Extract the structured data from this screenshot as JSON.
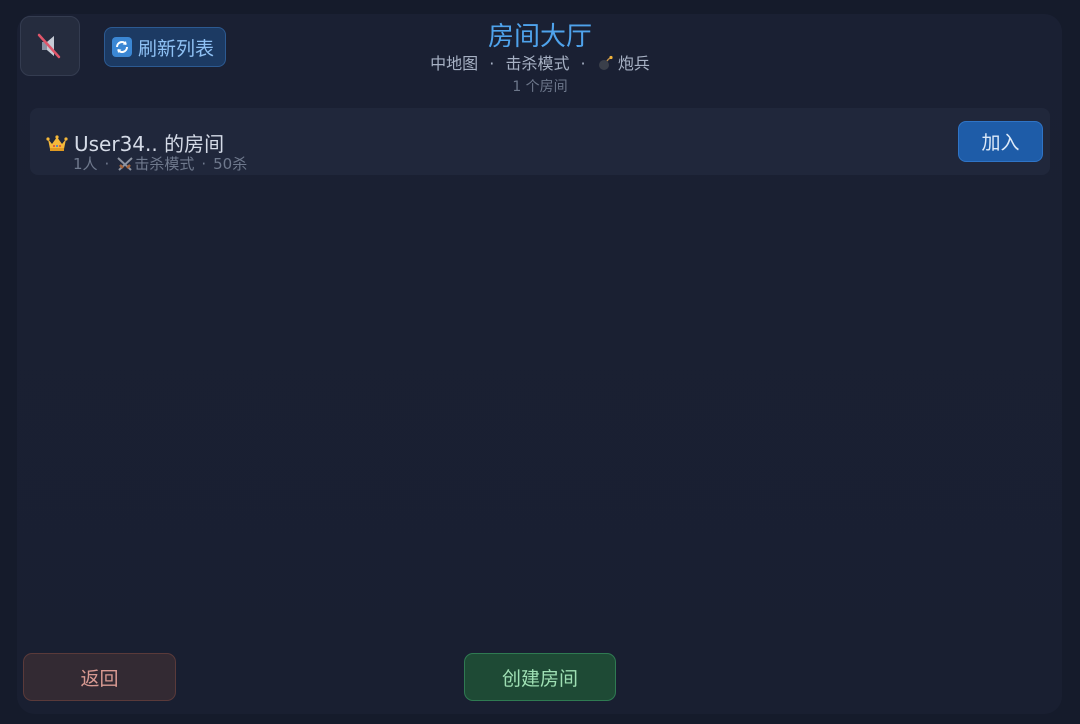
{
  "toolbar": {
    "mute_icon": "speaker-muted-icon",
    "refresh_label": "刷新列表",
    "refresh_icon": "refresh-icon"
  },
  "header": {
    "title": "房间大厅",
    "subtitle_map": "中地图",
    "subtitle_sep1": "·",
    "subtitle_mode": "击杀模式",
    "subtitle_sep2": "·",
    "subtitle_class_icon": "bomb-icon",
    "subtitle_class": "炮兵",
    "room_count": "1 个房间"
  },
  "rooms": [
    {
      "owner_icon": "crown-icon",
      "name": "User34.. 的房间",
      "players": "1人",
      "sep1": "·",
      "mode_icon": "crossed-swords-icon",
      "mode": "击杀模式",
      "sep2": "·",
      "target": "50杀",
      "join_label": "加入"
    }
  ],
  "footer": {
    "back_label": "返回",
    "create_label": "创建房间"
  },
  "colors": {
    "title": "#4fa3ec",
    "join_button": "#1e5ca8",
    "create_button": "#1e4a35",
    "back_button": "#332a33"
  }
}
